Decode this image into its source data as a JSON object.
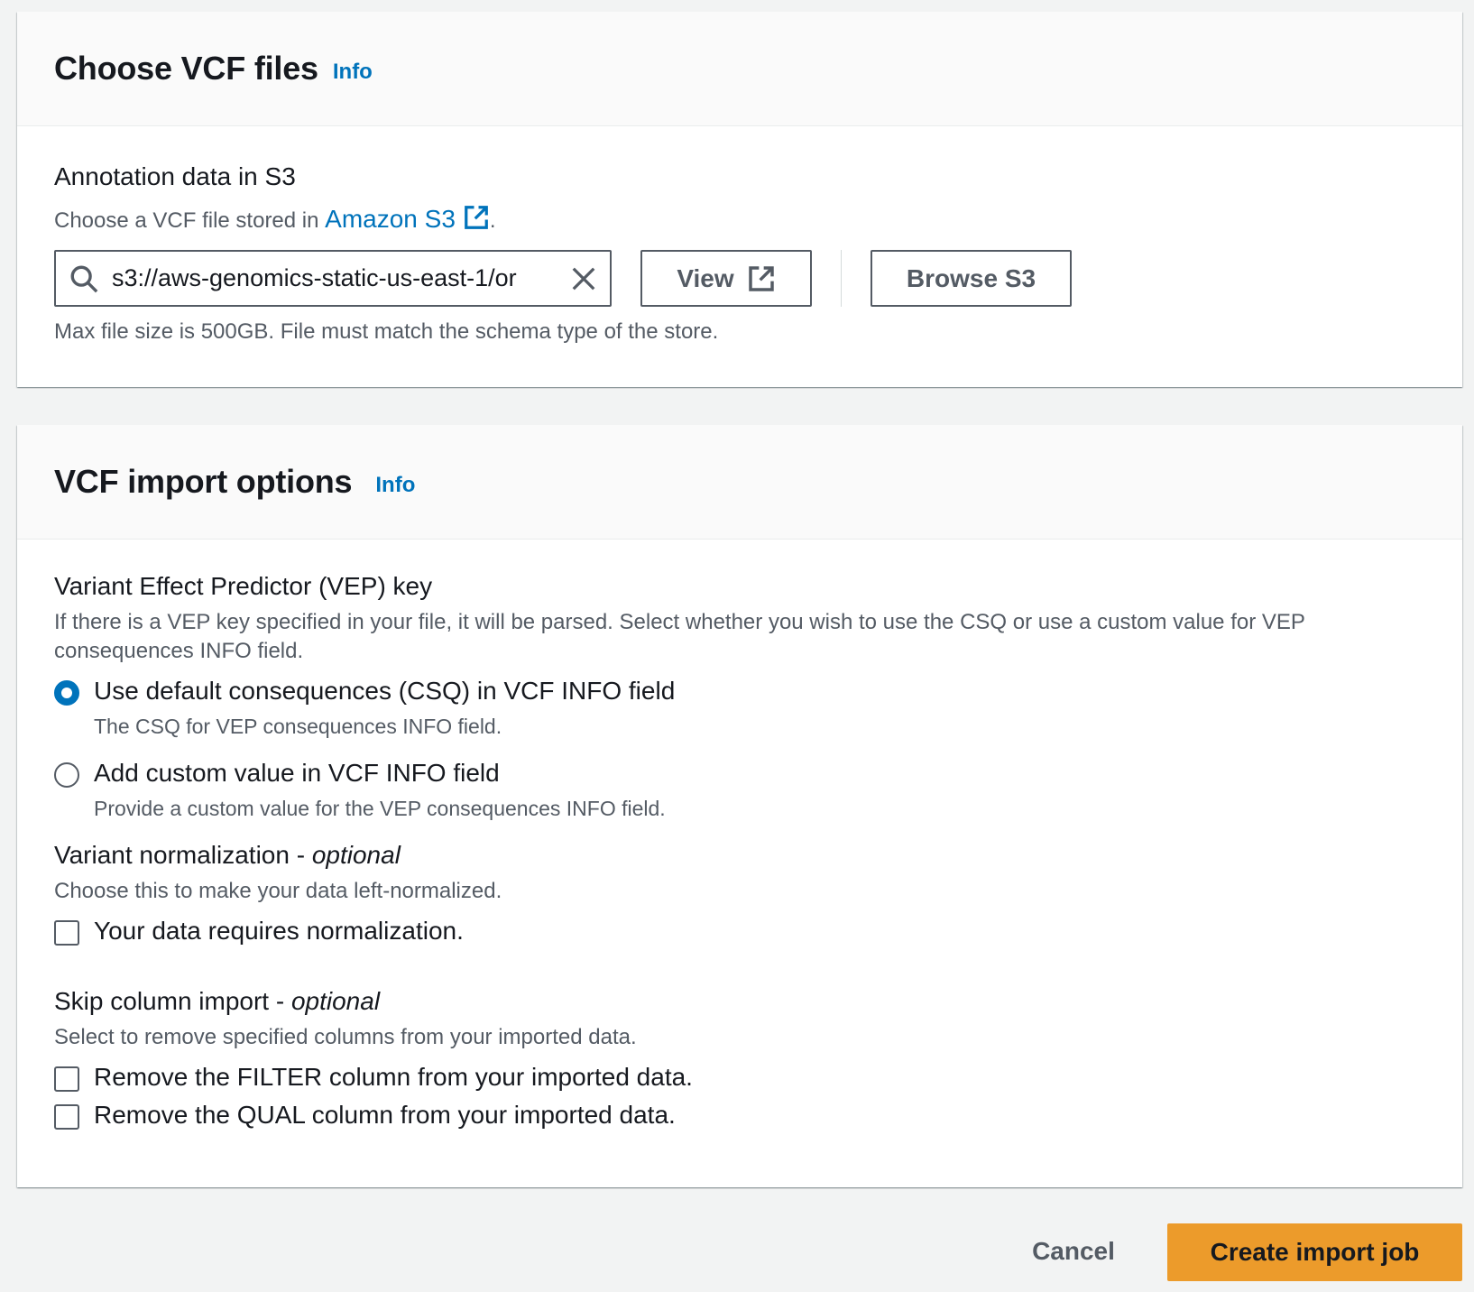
{
  "vcf_files": {
    "title": "Choose VCF files",
    "info": "Info",
    "annotation_label": "Annotation data in S3",
    "desc_prefix": "Choose a VCF file stored in ",
    "s3_link": "Amazon S3",
    "desc_suffix": ".",
    "search_value": "s3://aws-genomics-static-us-east-1/or",
    "view_label": "View",
    "browse_label": "Browse S3",
    "constraint": "Max file size is 500GB. File must match the schema type of the store."
  },
  "import_options": {
    "title": "VCF import options",
    "info": "Info",
    "vep": {
      "label": "Variant Effect Predictor (VEP) key",
      "desc": "If there is a VEP key specified in your file, it will be parsed. Select whether you wish to use the CSQ or use a custom value for VEP consequences INFO field.",
      "options": [
        {
          "label": "Use default consequences (CSQ) in VCF INFO field",
          "desc": "The CSQ for VEP consequences INFO field.",
          "selected": true
        },
        {
          "label": "Add custom value in VCF INFO field",
          "desc": "Provide a custom value for the VEP consequences INFO field.",
          "selected": false
        }
      ]
    },
    "normalization": {
      "label": "Variant normalization - ",
      "optional": "optional",
      "desc": "Choose this to make your data left-normalized.",
      "checkbox": "Your data requires normalization."
    },
    "skip_columns": {
      "label": "Skip column import - ",
      "optional": "optional",
      "desc": "Select to remove specified columns from your imported data.",
      "filter": "Remove the FILTER column from your imported data.",
      "qual": "Remove the QUAL column from your imported data."
    }
  },
  "footer": {
    "cancel": "Cancel",
    "create": "Create import job"
  },
  "colors": {
    "link": "#0073bb",
    "primary_button": "#ec9b2b",
    "text": "#16191f",
    "secondary_text": "#545b64"
  }
}
